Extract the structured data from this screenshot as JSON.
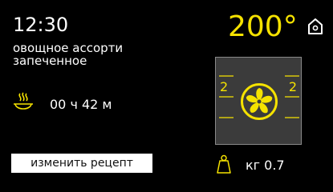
{
  "status": {
    "time": "12:30",
    "recipe_line1": "овощное ассорти",
    "recipe_line2": "запеченное",
    "temperature": "200°"
  },
  "cooking": {
    "duration": "00 ч 42 м",
    "timer_icon": "steaming-dish-icon"
  },
  "actions": {
    "change_recipe_label": "изменить рецепт",
    "home_icon": "home-icon"
  },
  "oven": {
    "mode_icon": "convection-fan-icon",
    "level_left": "2",
    "level_right": "2"
  },
  "weight": {
    "text": "кг 0.7",
    "icon": "weight-icon"
  },
  "colors": {
    "accent": "#f5e200",
    "background": "#000000",
    "panel": "#3b3b3b"
  }
}
